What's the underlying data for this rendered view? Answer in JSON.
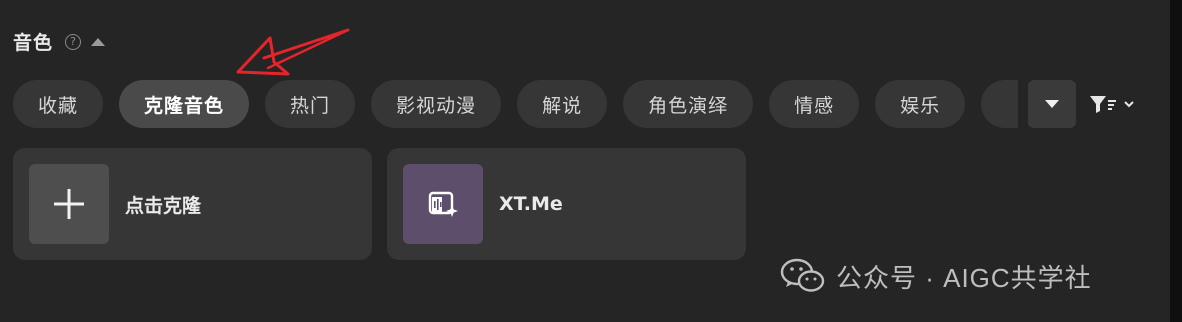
{
  "section": {
    "title": "音色",
    "help_symbol": "?"
  },
  "tabs": [
    {
      "label": "收藏",
      "active": false
    },
    {
      "label": "克隆音色",
      "active": true
    },
    {
      "label": "热门",
      "active": false
    },
    {
      "label": "影视动漫",
      "active": false
    },
    {
      "label": "解说",
      "active": false
    },
    {
      "label": "角色演绎",
      "active": false
    },
    {
      "label": "情感",
      "active": false
    },
    {
      "label": "娱乐",
      "active": false
    },
    {
      "label": "",
      "active": false
    }
  ],
  "cards": {
    "clone": {
      "label": "点击克隆",
      "icon": "plus-icon"
    },
    "voice": {
      "label": "XT.Me",
      "icon": "voice-clone-icon"
    }
  },
  "watermark": {
    "text": "公众号 · AIGC共学社",
    "icon": "wechat-icon"
  },
  "colors": {
    "background": "#252526",
    "tab_bg": "#363637",
    "tab_active_bg": "#4a4a4b",
    "annotation_arrow": "#e5252a",
    "voice_thumb": "#5d4e6b"
  }
}
